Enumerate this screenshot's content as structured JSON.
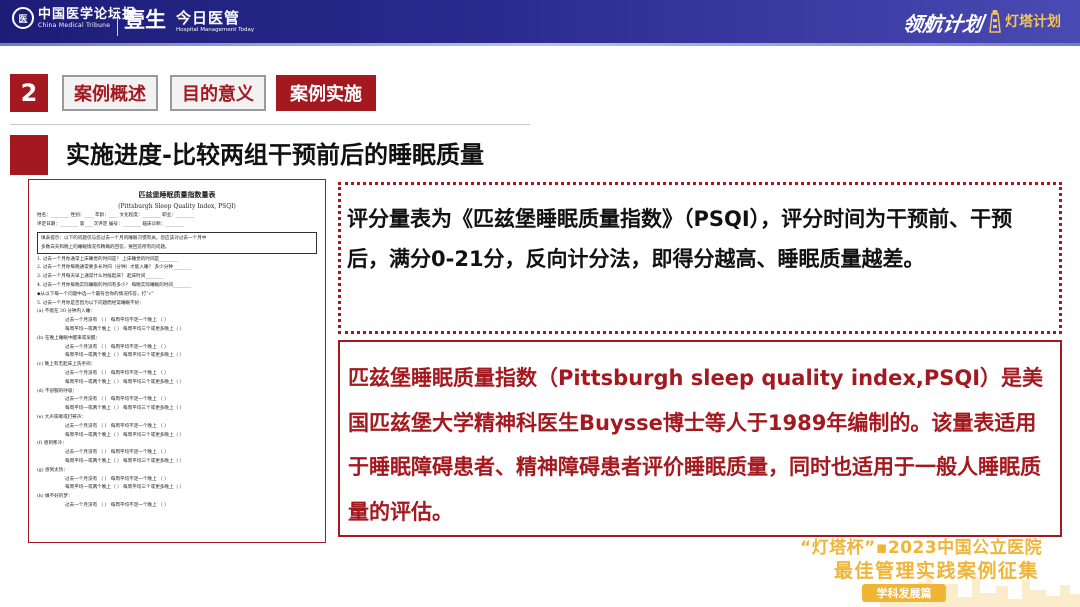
{
  "header": {
    "logo_cmt_cn": "中国医学论坛报",
    "logo_cmt_en": "China Medical Tribune",
    "logo_yisheng": "壹生",
    "logo_jryg": "今日医管",
    "logo_jryg_en": "Hospital Management Today",
    "logo_lhjh": "领航计划",
    "logo_dengta": "灯塔计划"
  },
  "section": {
    "number": "2",
    "tabs": [
      {
        "label": "案例概述",
        "active": false
      },
      {
        "label": "目的意义",
        "active": false
      },
      {
        "label": "案例实施",
        "active": true
      }
    ],
    "title": "实施进度-比较两组干预前后的睡眠质量"
  },
  "psqi_form": {
    "title": "匹兹堡睡眠质量指数量表",
    "subtitle": "(Pittsburgh Sleep Quality Index, PSQI)",
    "info_line1": "姓名：________ 性别：____ 年龄：____ 文化程度：________ 职业：________",
    "info_line2": "评定日期：________ 第____次评定 编号：________ 临床诊断：________",
    "instruction_1": "填表提示：以下的问题仅与您过去一个月的睡眠习惯有关。您应该对过去一个月中",
    "instruction_2": "多数白天和晚上的睡眠情况作精确的回答，要回答所有的问题。",
    "questions": [
      "1. 过去一个月你通常上床睡觉的时间是？ 上床睡觉的时间是________",
      "2. 过去一个月你每晚通常要多长时间（分钟）才能入睡？ 多少分钟________",
      "3. 过去一个月每天早上通常什么时候起床？ 起床时间________",
      "4. 过去一个月你每晚实际睡眠的时间有多少？ 每晚实际睡眠的时间________",
      "◆从以下每一个问题中选一个最符合你的情况作答，打“√”",
      "5. 过去一个月你是否因为以下问题而经常睡眠不好："
    ],
    "sub_items": [
      "(a) 不能在 30 分钟内入睡：",
      "(b) 在晚上睡眠中醒来或早醒：",
      "(c) 晚上有无起床上洗手间：",
      "(d) 不舒服的呼吸：",
      "(e) 大声咳嗽或打鼾声：",
      "(f) 感到寒冷：",
      "(g) 感到太热：",
      "(h) 做不好的梦："
    ],
    "options": [
      "过去一个月没有  （ ）    每周平均不足一个晚上  （ ）",
      "每周平均一或两个晚上（ ）    每周平均三个或更多晚上（ ）"
    ]
  },
  "box1_text": "评分量表为《匹兹堡睡眠质量指数》（PSQI），评分时间为干预前、干预后，满分0-21分，反向计分法，即得分越高、睡眠质量越差。",
  "box2_text": "匹兹堡睡眠质量指数（Pittsburgh sleep quality index,PSQI）是美国匹兹堡大学精神科医生Buysse博士等人于1989年编制的。该量表适用于睡眠障碍患者、精神障碍患者评价睡眠质量，同时也适用于一般人睡眠质量的评估。",
  "footer": {
    "line1": "“灯塔杯”▪2023中国公立医院",
    "line2": "最佳管理实践案例征集",
    "badge": "学科发展篇"
  },
  "colors": {
    "brand_red": "#a3191f",
    "header_blue": "#2a2a8e",
    "gold": "#f0b535"
  }
}
